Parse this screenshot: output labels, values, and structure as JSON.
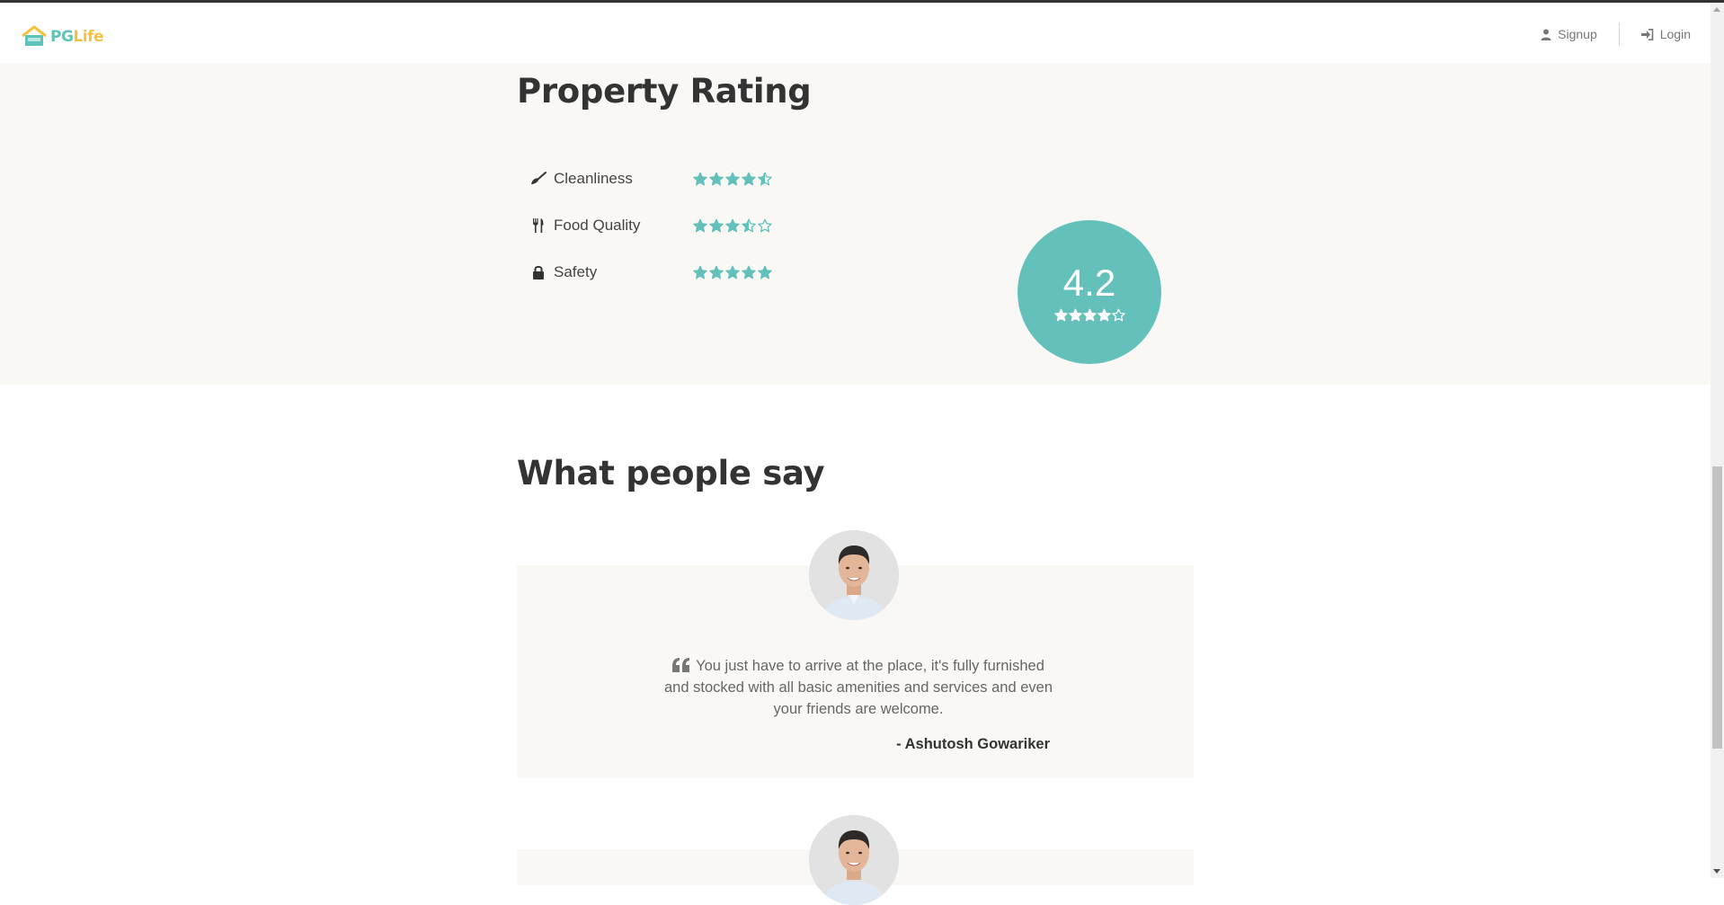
{
  "brand": {
    "pg": "PG",
    "life": "Life"
  },
  "nav": {
    "signup": "Signup",
    "login": "Login"
  },
  "rating": {
    "title": "Property Rating",
    "items": [
      {
        "label": "Cleanliness",
        "icon": "broom-icon",
        "stars": 4.5
      },
      {
        "label": "Food Quality",
        "icon": "utensils-icon",
        "stars": 3.5
      },
      {
        "label": "Safety",
        "icon": "lock-icon",
        "stars": 5
      }
    ],
    "overall": {
      "score": "4.2",
      "stars": 4
    }
  },
  "testimonials": {
    "title": "What people say",
    "items": [
      {
        "quote": "You just have to arrive at the place, it's fully furnished and stocked with all basic amenities and services and even your friends are welcome.",
        "author": "- Ashutosh Gowariker"
      }
    ]
  },
  "colors": {
    "accent": "#63c0bb",
    "star": "#63c0bb",
    "section_bg": "#f9f8f5",
    "brand_yellow": "#f6c23e"
  }
}
